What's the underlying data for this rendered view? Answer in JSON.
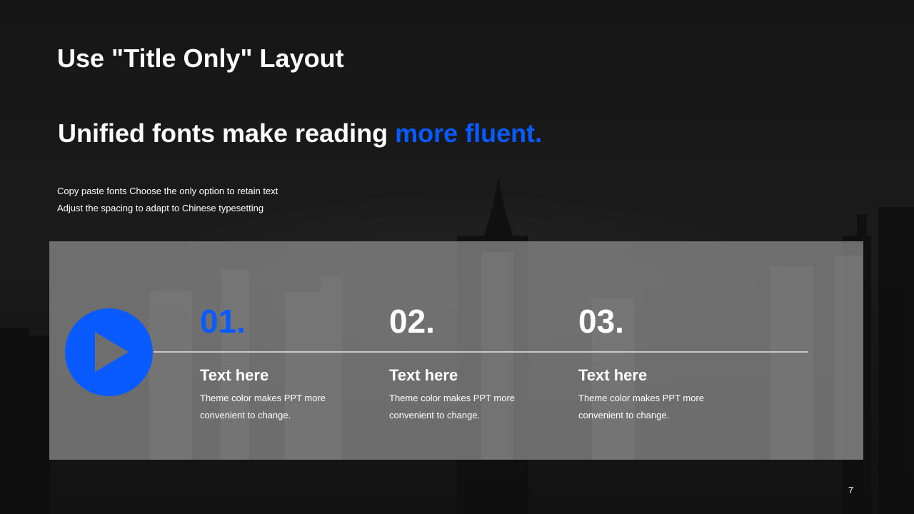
{
  "slide": {
    "title": "Use \"Title Only\" Layout",
    "headline": {
      "main": "Unified fonts make reading ",
      "accent": "more fluent."
    },
    "description": [
      "Copy paste fonts Choose the only option to retain text",
      "Adjust the spacing to adapt to Chinese typesetting"
    ],
    "steps": [
      {
        "number": "01.",
        "title": "Text here",
        "text": "Theme color makes PPT more convenient  to change."
      },
      {
        "number": "02.",
        "title": "Text here",
        "text": "Theme color makes PPT more convenient  to change."
      },
      {
        "number": "03.",
        "title": "Text here",
        "text": "Theme color makes PPT more convenient  to change."
      }
    ],
    "page_number": "7"
  },
  "icons": {
    "play": "play-icon"
  },
  "colors": {
    "accent": "#0a5bff",
    "background": "#141414",
    "panel": "#8c8c8c",
    "text": "#ffffff"
  }
}
